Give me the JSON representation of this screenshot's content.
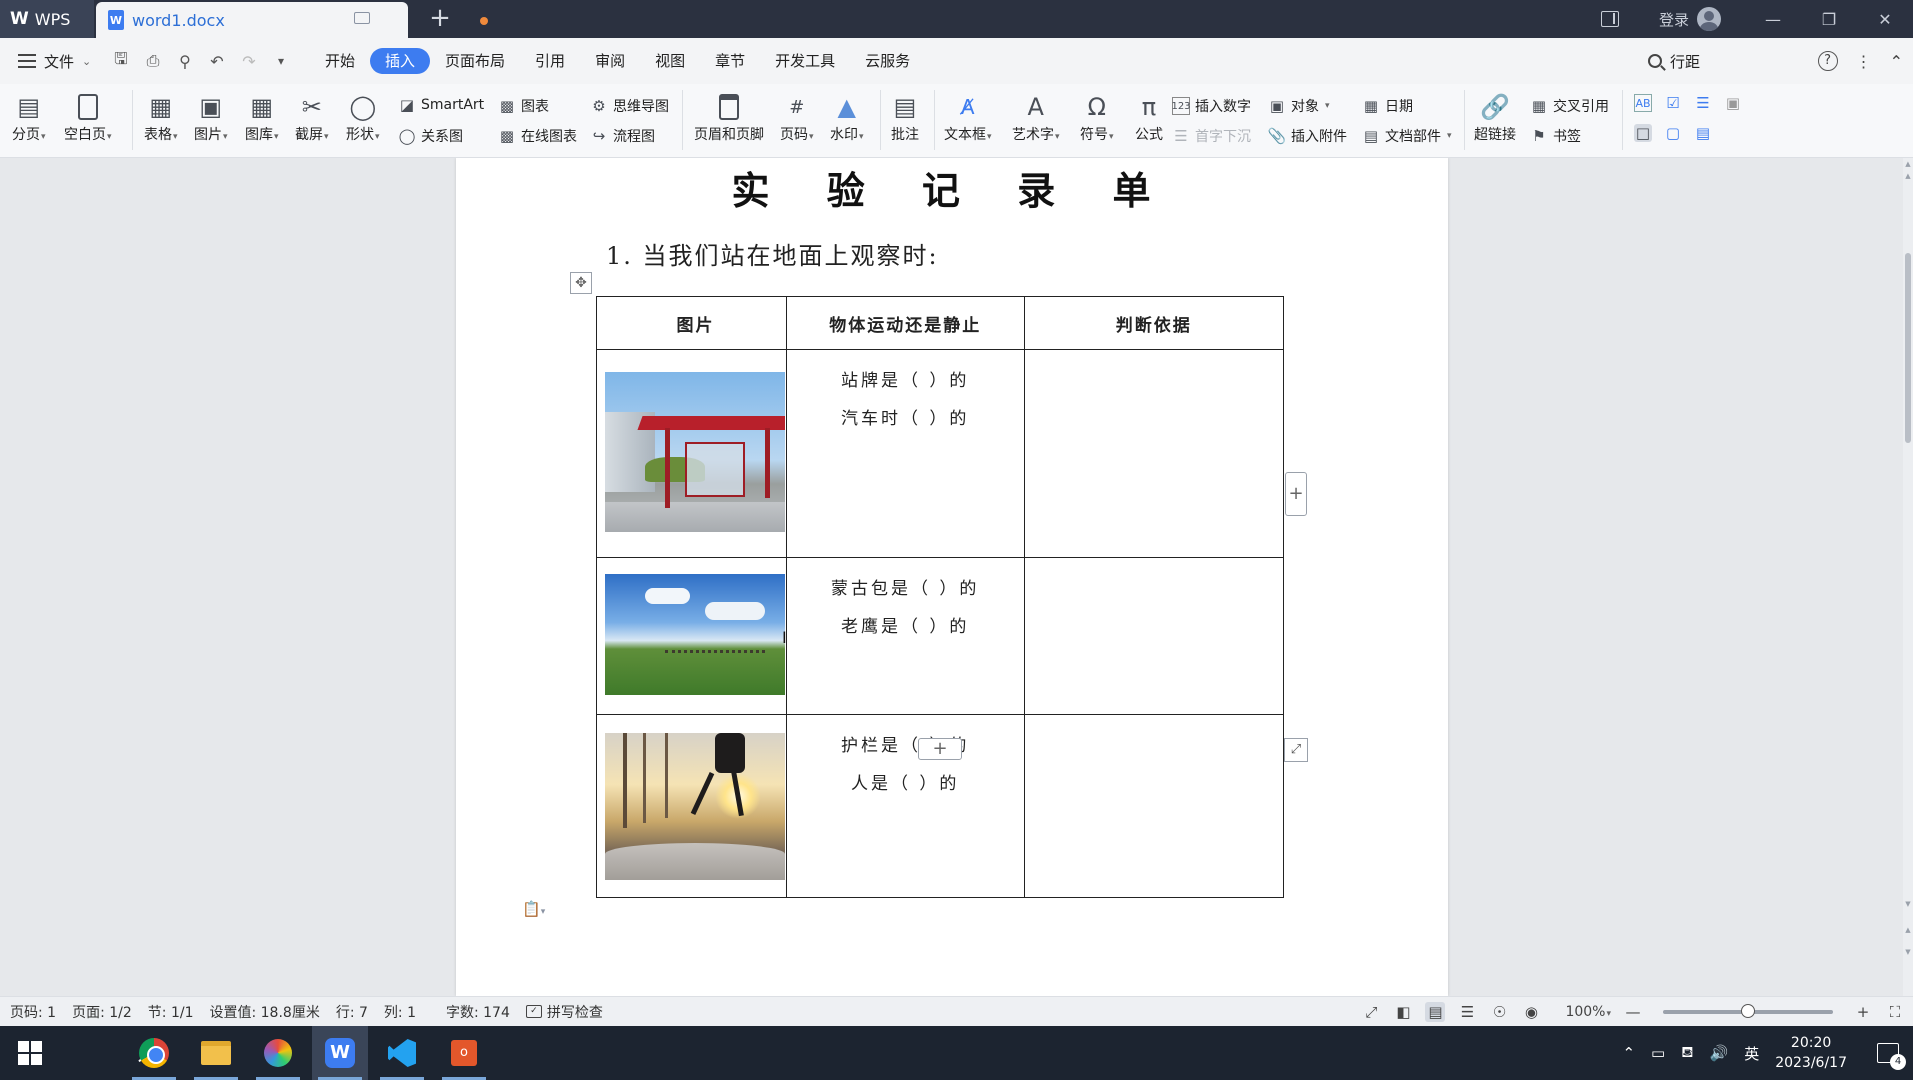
{
  "titlebar": {
    "app_name": "WPS",
    "doc_tab": "word1.docx",
    "new_tab": "+",
    "login": "登录"
  },
  "menubar": {
    "file": "文件",
    "tabs": [
      "开始",
      "插入",
      "页面布局",
      "引用",
      "审阅",
      "视图",
      "章节",
      "开发工具",
      "云服务"
    ],
    "active_tab": "插入",
    "search_label": "行距"
  },
  "ribbon": {
    "page_break": "分页",
    "blank_page": "空白页",
    "table": "表格",
    "picture": "图片",
    "gallery": "图库",
    "screenshot": "截屏",
    "shapes": "形状",
    "smartart": "SmartArt",
    "chart": "图表",
    "relation": "关系图",
    "online_chart": "在线图表",
    "mindmap": "思维导图",
    "flowchart": "流程图",
    "header_footer": "页眉和页脚",
    "page_number": "页码",
    "watermark": "水印",
    "comment": "批注",
    "textbox": "文本框",
    "wordart": "艺术字",
    "symbol": "符号",
    "formula": "公式",
    "insert_number": "插入数字",
    "drop_cap": "首字下沉",
    "object": "对象",
    "attachment": "插入附件",
    "date": "日期",
    "doc_parts": "文档部件",
    "hyperlink": "超链接",
    "cross_ref": "交叉引用",
    "bookmark": "书签"
  },
  "document": {
    "title": "实 验 记 录 单",
    "question": "1. 当我们站在地面上观察时:",
    "table": {
      "headers": [
        "图片",
        "物体运动还是静止",
        "判断依据"
      ],
      "rows": [
        {
          "lines": [
            "站牌是（  ）的",
            "汽车时（  ）的"
          ],
          "basis": ""
        },
        {
          "lines": [
            "蒙古包是（  ）的",
            "老鹰是（  ）的"
          ],
          "basis": ""
        },
        {
          "lines": [
            "护栏是（  ）的",
            "人是（  ）的"
          ],
          "basis": ""
        }
      ]
    }
  },
  "statusbar": {
    "page_code": "页码: 1",
    "pages": "页面: 1/2",
    "section": "节: 1/1",
    "setting": "设置值: 18.8厘米",
    "line": "行: 7",
    "column": "列: 1",
    "word_count": "字数: 174",
    "spell_check": "拼写检查",
    "zoom": "100%",
    "zoom_level": 0.5
  },
  "taskbar": {
    "ime": "英",
    "time": "20:20",
    "date": "2023/6/17",
    "notifications": "4"
  },
  "colors": {
    "accent": "#3d7cf0",
    "titlebar_bg": "#2b3140",
    "taskbar_bg": "#1c2430"
  }
}
